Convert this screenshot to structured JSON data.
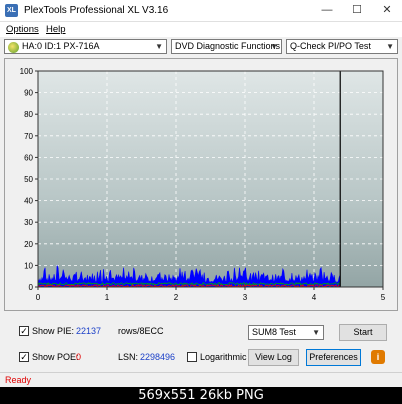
{
  "window": {
    "title": "PlexTools Professional XL V3.16",
    "icon_text": "XL"
  },
  "menu": {
    "options": "Options",
    "help": "Help"
  },
  "toolbar": {
    "drive": "HA:0 ID:1  PX-716A",
    "function": "DVD Diagnostic Functions",
    "test": "Q-Check  PI/PO Test"
  },
  "chart_data": {
    "type": "line",
    "title": "",
    "xlabel": "",
    "ylabel": "",
    "xlim": [
      0,
      5
    ],
    "ylim": [
      0,
      100
    ],
    "x_ticks": [
      "0",
      "1",
      "2",
      "3",
      "4",
      "5"
    ],
    "y_ticks": [
      "0",
      "10",
      "20",
      "30",
      "40",
      "50",
      "60",
      "70",
      "80",
      "90",
      "100"
    ],
    "grid": true,
    "end_marker_x": 4.38,
    "series": [
      {
        "color": "#0000ff",
        "x_range": [
          0,
          4.38
        ],
        "typical": [
          2,
          6
        ],
        "peaks": [
          [
            0.1,
            9
          ],
          [
            0.28,
            10
          ],
          [
            0.37,
            8
          ],
          [
            0.55,
            7
          ],
          [
            1.05,
            7
          ],
          [
            2.3,
            7
          ],
          [
            2.92,
            9
          ],
          [
            3.12,
            8
          ],
          [
            3.55,
            7
          ],
          [
            3.9,
            8
          ],
          [
            4.1,
            9
          ],
          [
            4.25,
            8
          ]
        ]
      },
      {
        "color": "#ff0000",
        "x_range": [
          0,
          4.38
        ],
        "typical": [
          0,
          1
        ]
      },
      {
        "color": "#00aa00",
        "x_range": [
          0,
          4.38
        ],
        "typical": [
          1,
          2
        ]
      }
    ]
  },
  "stats": {
    "show_pie_label": "Show PIE:",
    "pie_value": "22137",
    "pie_unit": "rows/8ECC",
    "show_poe_label": "Show POE:",
    "poe_value": "0",
    "lsn_label": "LSN:",
    "lsn_value": "2298496",
    "logarithmic_label": "Logarithmic"
  },
  "controls": {
    "mode": "SUM8 Test",
    "start": "Start",
    "view_log": "View Log",
    "preferences": "Preferences",
    "info_icon": "i"
  },
  "status": {
    "text": "Ready"
  },
  "footer": {
    "text": "569x551  26kb  PNG"
  }
}
